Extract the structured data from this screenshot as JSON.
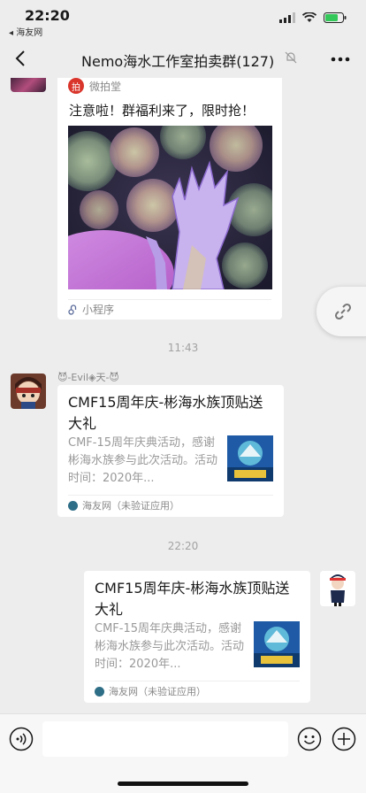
{
  "status_bar": {
    "time": "22:20",
    "back_app": "◂ 海友网"
  },
  "nav": {
    "title": "Nemo海水工作室拍卖群(127)",
    "icons": [
      "back-chevron-icon",
      "mute-bell-icon",
      "more-icon"
    ]
  },
  "messages": {
    "mini_program": {
      "source": "微拍堂",
      "text": "注意啦！群福利来了，限时抢！",
      "footer": "小程序"
    },
    "time1": "11:43",
    "incoming": {
      "sender": "😈-Evil◈天-😈",
      "title": "CMF15周年庆-彬海水族顶贴送大礼",
      "desc": "CMF-15周年庆典活动，感谢彬海水族参与此次活动。活动时间：2020年...",
      "footer": "海友网（未验证应用）"
    },
    "time2": "22:20",
    "outgoing": {
      "title": "CMF15周年庆-彬海水族顶贴送大礼",
      "desc": "CMF-15周年庆典活动，感谢彬海水族参与此次活动。活动时间：2020年...",
      "footer": "海友网（未验证应用）"
    }
  },
  "input_bar": {
    "placeholder": ""
  },
  "colors": {
    "background": "#EDEDED",
    "bubble": "#FFFFFF",
    "accent_green": "#07C160"
  }
}
